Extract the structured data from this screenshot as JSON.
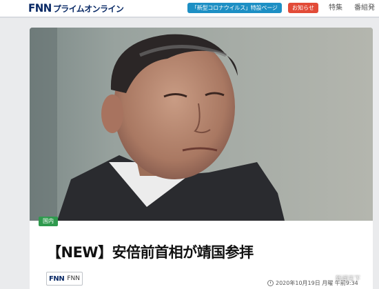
{
  "header": {
    "logo_fnn": "FNN",
    "logo_rest": "プライムオンライン",
    "covid_button": "「新型コロナウイルス」特設ページ",
    "notice_button": "お知らせ",
    "nav": [
      "特集",
      "番組発"
    ]
  },
  "article": {
    "category": "国内",
    "headline": "【NEW】安倍前首相が靖国参拝",
    "source_fnn": "FNN",
    "source_name": "FNN",
    "timestamp": "2020年10月19日 月曜 午前9:34"
  },
  "watermark": "新闻天下",
  "colors": {
    "brand_navy": "#0a2a66",
    "covid_blue": "#1d8fc4",
    "notice_red": "#e24b38",
    "category_green": "#2f9a4e"
  }
}
